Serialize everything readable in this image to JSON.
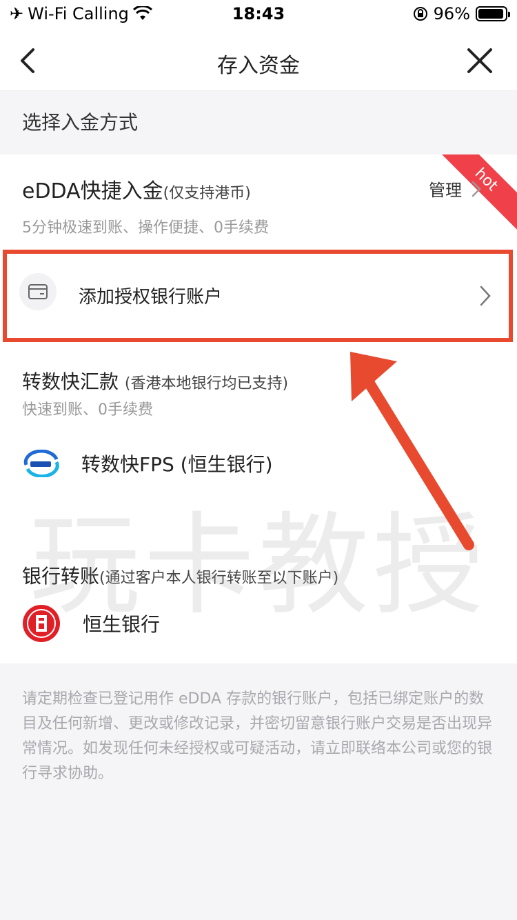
{
  "status_bar": {
    "carrier": "Wi-Fi Calling",
    "time": "18:43",
    "battery": "96%",
    "battery_level": 0.96
  },
  "nav": {
    "title": "存入资金"
  },
  "section_label": "选择入金方式",
  "edda": {
    "title": "eDDA快捷入金",
    "subtitle": "(仅支持港币)",
    "manage": "管理",
    "desc": "5分钟极速到账、操作便捷、0手续费",
    "badge": "hot"
  },
  "add_bank": {
    "label": "添加授权银行账户"
  },
  "fps": {
    "title": "转数快汇款",
    "subtitle": "(香港本地银行均已支持)",
    "desc": "快速到账、0手续费",
    "bank_name": "转数快FPS (恒生银行)"
  },
  "bank_transfer": {
    "title": "银行转账",
    "subtitle": "(通过客户本人银行转账至以下账户)",
    "bank_name": "恒生银行"
  },
  "notice": "请定期检查已登记用作 eDDA 存款的银行账户，包括已绑定账户的数目及任何新增、更改或修改记录，并密切留意银行账户交易是否出现异常情况。如发现任何未经授权或可疑活动，请立即联络本公司或您的银行寻求协助。",
  "watermark": "玩卡教授",
  "colors": {
    "highlight": "#e84a2f",
    "hot": "#f0414a"
  }
}
